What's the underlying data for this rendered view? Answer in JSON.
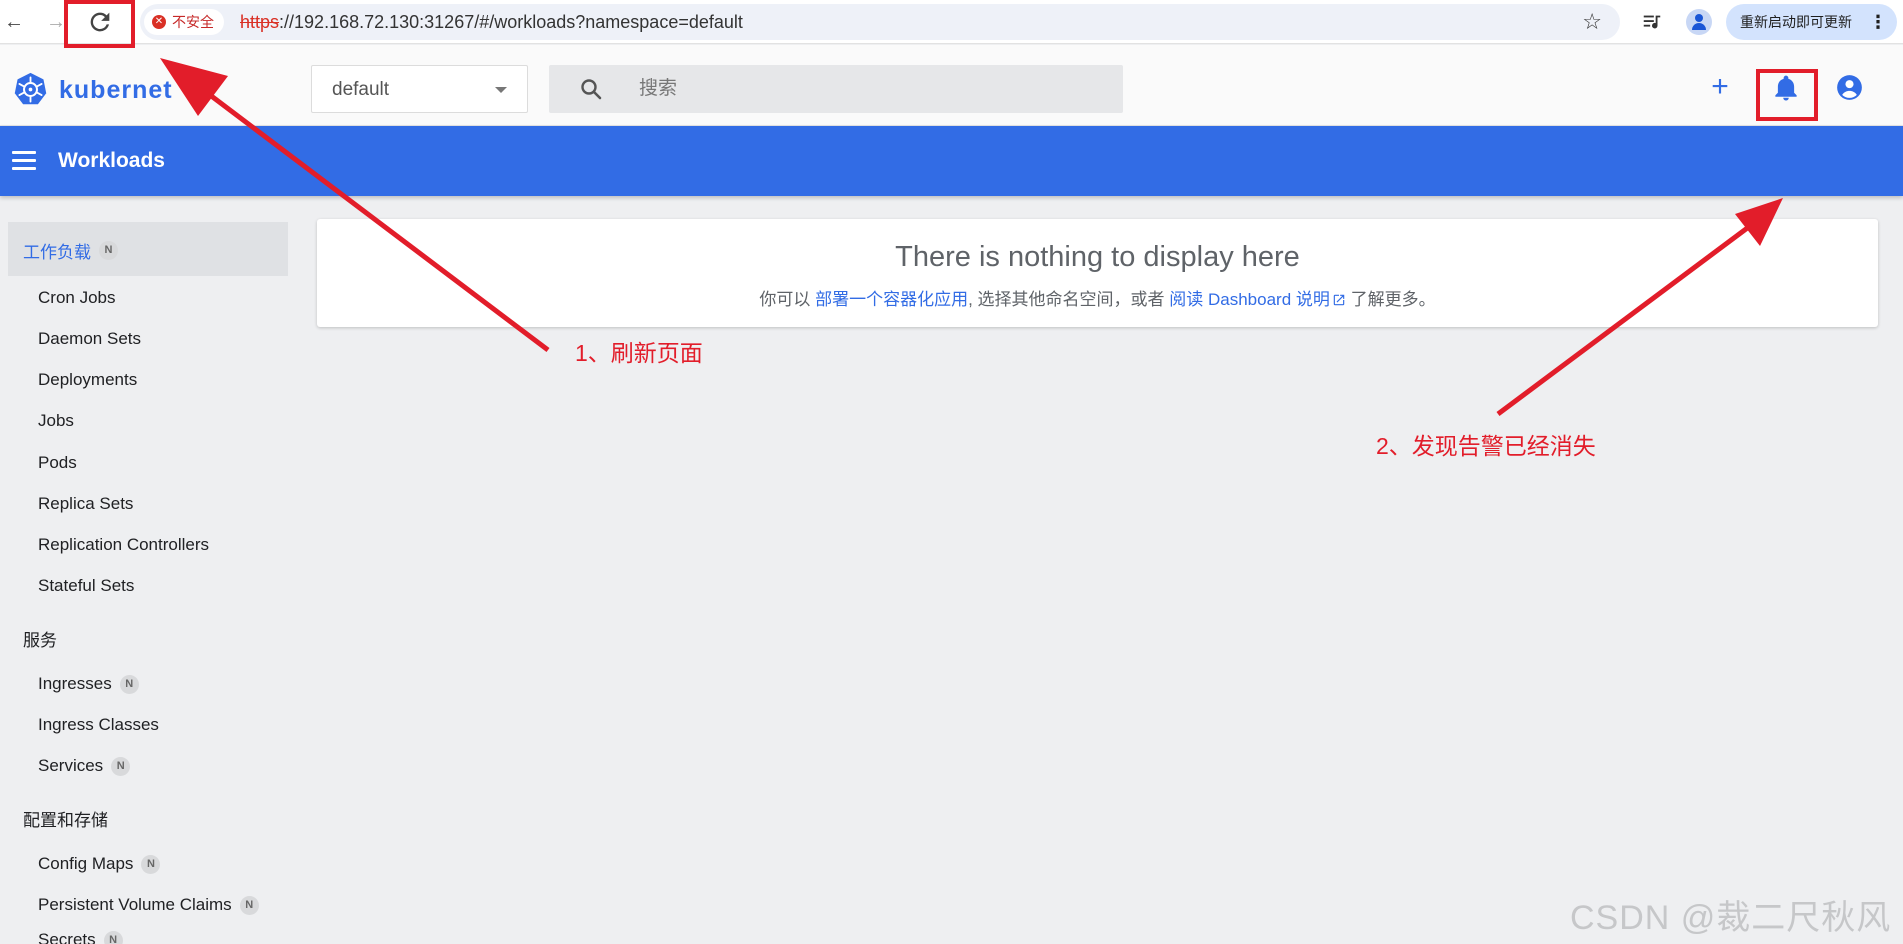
{
  "browser": {
    "security_label": "不安全",
    "url_protocol": "https",
    "url_rest": "://192.168.72.130:31267/#/workloads?namespace=default",
    "update_button": "重新启动即可更新"
  },
  "app": {
    "logo_text": "kubernet",
    "namespace": "default",
    "search_placeholder": "搜索",
    "page_title": "Workloads"
  },
  "sidebar": {
    "sections": [
      {
        "label": "工作负载",
        "badge": "N",
        "items": [
          {
            "label": "Cron Jobs"
          },
          {
            "label": "Daemon Sets"
          },
          {
            "label": "Deployments"
          },
          {
            "label": "Jobs"
          },
          {
            "label": "Pods"
          },
          {
            "label": "Replica Sets"
          },
          {
            "label": "Replication Controllers"
          },
          {
            "label": "Stateful Sets"
          }
        ]
      },
      {
        "label": "服务",
        "items": [
          {
            "label": "Ingresses",
            "badge": "N"
          },
          {
            "label": "Ingress Classes"
          },
          {
            "label": "Services",
            "badge": "N"
          }
        ]
      },
      {
        "label": "配置和存储",
        "items": [
          {
            "label": "Config Maps",
            "badge": "N"
          },
          {
            "label": "Persistent Volume Claims",
            "badge": "N"
          },
          {
            "label": "Secrets",
            "badge": "N"
          }
        ]
      }
    ]
  },
  "empty_state": {
    "title": "There is nothing to display here",
    "text_prefix": "你可以 ",
    "link_deploy": "部署一个容器化应用",
    "text_middle": ", 选择其他命名空间，或者 ",
    "link_docs": "阅读 Dashboard 说明",
    "text_suffix": " 了解更多。"
  },
  "annotations": {
    "step1": "1、刷新页面",
    "step2": "2、发现告警已经消失",
    "color": "#e21d2a"
  },
  "watermark": "CSDN @裁二尺秋风",
  "colors": {
    "brand_blue": "#326ce5",
    "page_bg": "#eeeff1"
  }
}
